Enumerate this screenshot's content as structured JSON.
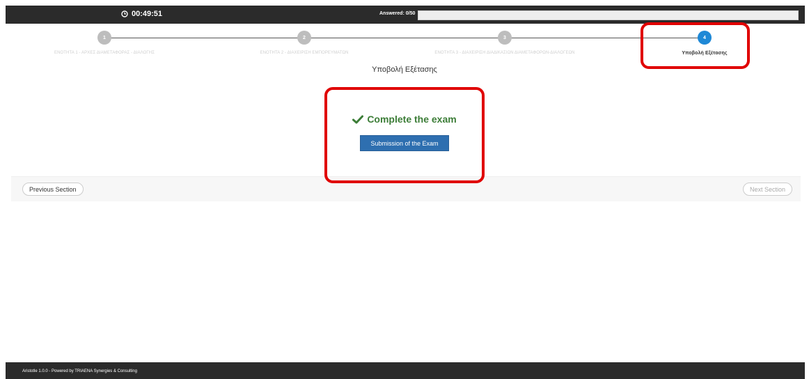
{
  "header": {
    "timer": "00:49:51",
    "answered_label": "Answered: 0/50",
    "progress_fraction": 0.0
  },
  "steps": [
    {
      "number": "1",
      "label": "ΕΝΟΤΗΤΑ 1 - ΑΡΧΕΣ ΔΙΑΜΕΤΑΦΟΡΑΣ - ΔΙΑΛΟΓΗΣ",
      "active": false
    },
    {
      "number": "2",
      "label": "ΕΝΟΤΗΤΑ 2 - ΔΙΑΧΕΙΡΙΣΗ ΕΜΠΟΡΕΥΜΑΤΩΝ",
      "active": false
    },
    {
      "number": "3",
      "label": "ΕΝΟΤΗΤΑ 3 - ΔΙΑΧΕΙΡΙΣΗ ΔΙΑΔΙΚΑΣΙΩΝ ΔΙΑΜΕΤΑΦΟΡΩΝ-ΔΙΑΛΟΓΕΩΝ",
      "active": false
    },
    {
      "number": "4",
      "label": "Υποβολή Εξέτασης",
      "active": true
    }
  ],
  "section_title": "Υποβολή Εξέτασης",
  "main": {
    "complete_heading": "Complete the exam",
    "submit_label": "Submission of the Exam"
  },
  "nav": {
    "previous_label": "Previous Section",
    "next_label": "Next Section"
  },
  "footer": {
    "text": "Aristotle 1.0.0 - Powered by TRIAENA Synergies & Consulting"
  },
  "colors": {
    "active_step": "#1e88d6",
    "inactive_step": "#bdbdbd",
    "success": "#3c7d37",
    "primary_button": "#2e6fb0",
    "annotation": "#e00000"
  }
}
